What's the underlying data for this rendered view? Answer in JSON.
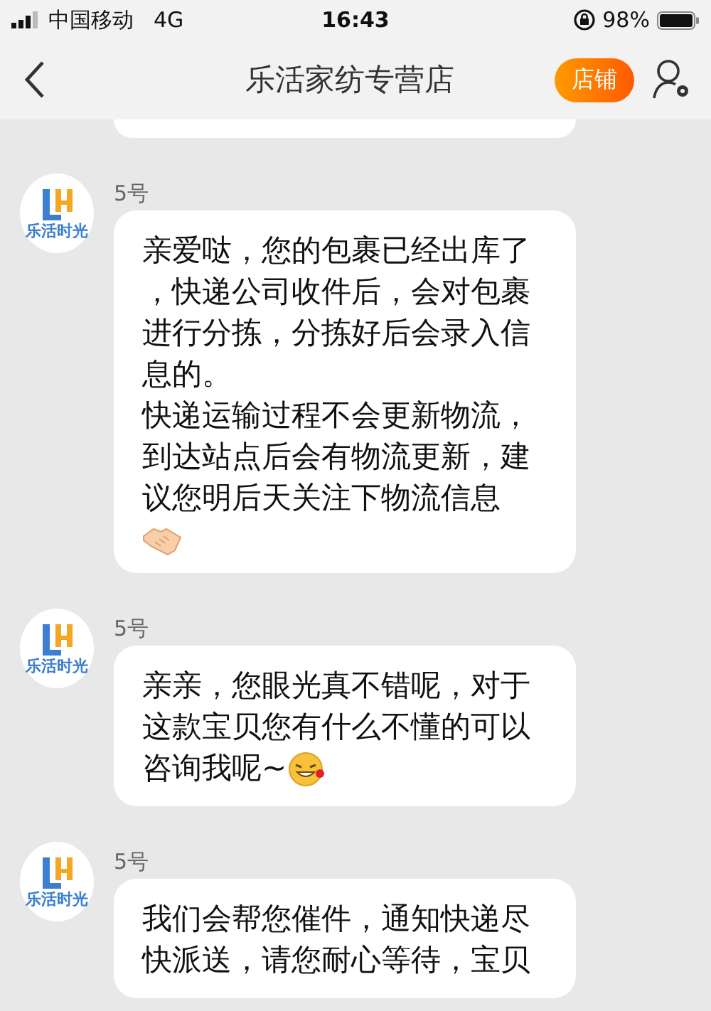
{
  "status_bar": {
    "carrier": "中国移动",
    "network": "4G",
    "time": "16:43",
    "battery": "98%"
  },
  "nav_bar": {
    "title": "乐活家纺专营店",
    "shop_button": "店铺"
  },
  "chat": {
    "earlier_bubble_visible": true,
    "messages": [
      {
        "avatar_label": "乐活时光",
        "sender": "5号",
        "paragraphs": [
          [
            {
              "kind": "text",
              "text": "亲爱哒，您的包裹已经出库了，快递公司收件后，会对包裹进行分拣，分拣好后会录入信息的。"
            }
          ],
          [
            {
              "kind": "text",
              "text": "快递运输过程不会更新物流，到达站点后会有物流更新，建议您明后天关注下物流信息"
            }
          ],
          [
            {
              "kind": "handshake"
            }
          ]
        ]
      },
      {
        "avatar_label": "乐活时光",
        "sender": "5号",
        "paragraphs": [
          [
            {
              "kind": "text",
              "text": "亲亲，您眼光真不错呢，对于这款宝贝您有什么不懂的可以"
            },
            {
              "kind": "text",
              "text": "咨询我呢~"
            },
            {
              "kind": "grin"
            }
          ]
        ]
      },
      {
        "avatar_label": "乐活时光",
        "sender": "5号",
        "paragraphs": [
          [
            {
              "kind": "text",
              "text": "我们会帮您催件，通知快递尽快派送，请您耐心等待，宝贝"
            }
          ]
        ]
      }
    ]
  }
}
